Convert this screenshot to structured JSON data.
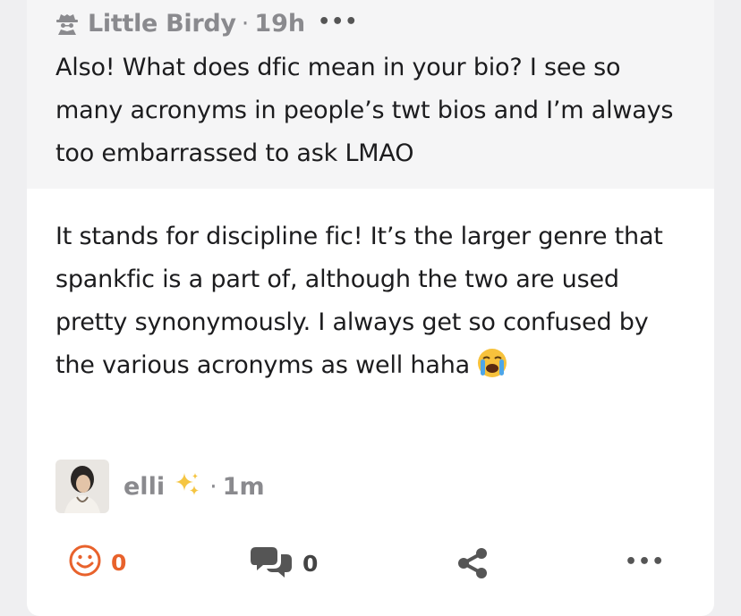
{
  "question": {
    "asker": "Little Birdy",
    "separator": "·",
    "time": "19h",
    "more": "•••",
    "text": "Also! What does dfic mean in your bio? I see so many acronyms in people’s twt bios and I’m always too embarrassed to ask LMAO"
  },
  "answer": {
    "text": "It stands for discipline fic! It’s the larger genre that spankfic is a part of, although the two are used pretty synonymously. I always get so confused by the various acronyms as well haha",
    "emoji": "loudly-crying-face"
  },
  "responder": {
    "name": "elli",
    "separator": "·",
    "time": "1m"
  },
  "actions": {
    "reactions_count": "0",
    "comments_count": "0",
    "more": "•••"
  },
  "colors": {
    "accent": "#e8622c",
    "muted": "#8a8a8e",
    "text": "#1c1c1e",
    "question_bg": "#f5f5f6"
  }
}
